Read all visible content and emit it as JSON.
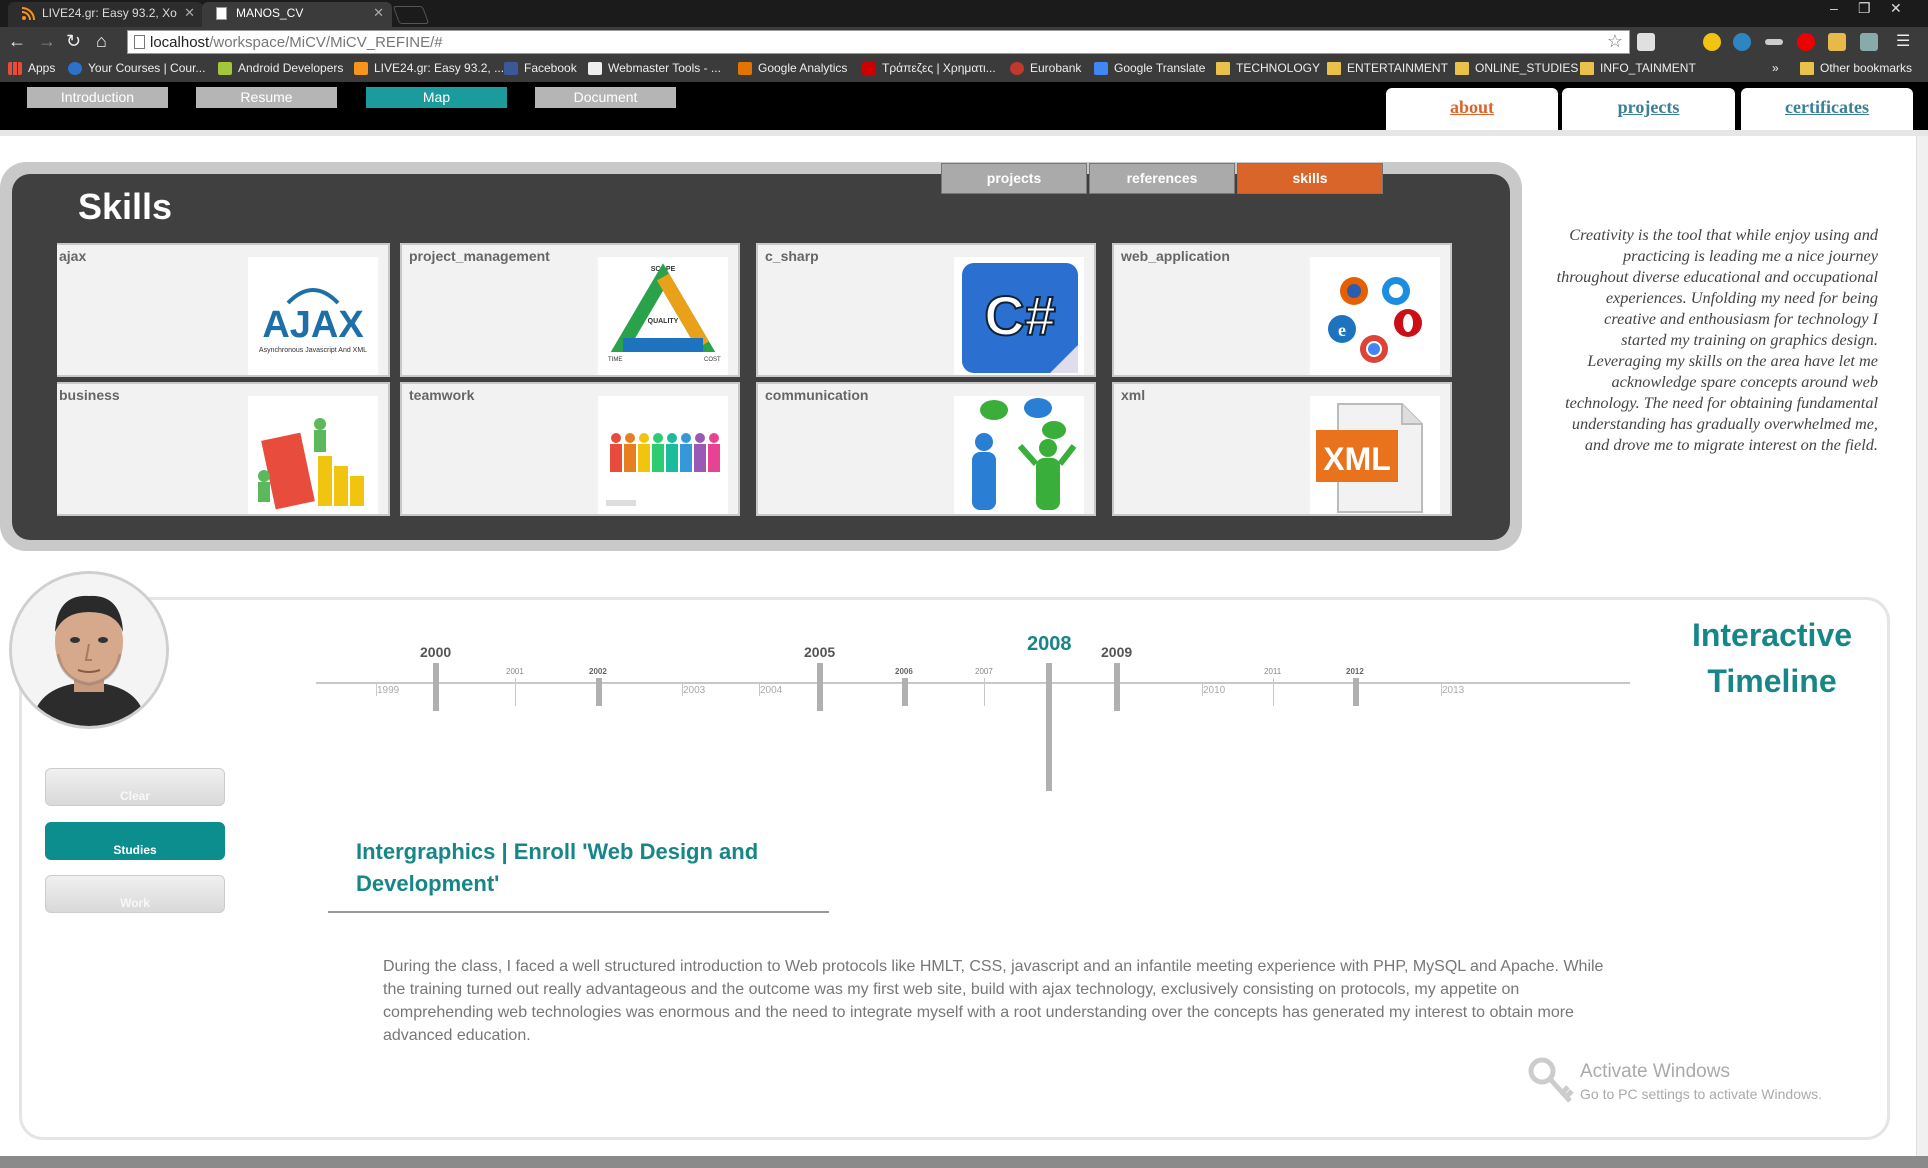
{
  "browser": {
    "tabs": [
      {
        "label": "LIVE24.gr: Easy 93.2, Xo"
      },
      {
        "label": "MANOS_CV"
      }
    ],
    "url_host": "localhost",
    "url_path": "/workspace/MiCV/MiCV_REFINE/#",
    "bookmarks": [
      "Apps",
      "Your Courses | Cour...",
      "Android Developers",
      "LIVE24.gr: Easy 93.2, ...",
      "Facebook",
      "Webmaster Tools - ...",
      "Google Analytics",
      "Τράπεζες | Χρηματι...",
      "Eurobank",
      "Google Translate",
      "TECHNOLOGY",
      "ENTERTAINMENT",
      "ONLINE_STUDIES",
      "INFO_TAINMENT"
    ],
    "other_bookmarks": "Other bookmarks",
    "more": "»"
  },
  "site_nav": {
    "left": [
      "Introduction",
      "Resume",
      "Map",
      "Document"
    ],
    "right": [
      "about",
      "projects",
      "certificates"
    ]
  },
  "skills": {
    "title": "Skills",
    "tabs": [
      "projects",
      "references",
      "skills"
    ],
    "cards": [
      "ajax",
      "project_management",
      "c_sharp",
      "web_application",
      "business",
      "teamwork",
      "communication",
      "xml"
    ],
    "image_text": {
      "ajax_big": "AJAX",
      "ajax_small": "Asynchronous Javascript And XML",
      "pm_scope": "SCOPE",
      "pm_quality": "QUALITY",
      "pm_time": "TIME",
      "pm_cost": "COST",
      "csharp": "C#",
      "xml": "XML"
    }
  },
  "quote": "Creativity is the tool that while enjoy using and practicing is leading me a nice journey throughout diverse educational and occupational experiences. Unfolding my need for being creative and enthousiasm for technology I started my training on graphics design. Leveraging my skills on the area have let me acknowledge spare concepts around web technology. The need for obtaining fundamental understanding has gradually overwhelmed me, and drove me to migrate interest on the field.",
  "timeline": {
    "title": "Interactive Timeline",
    "buttons": [
      "Clear",
      "Studies",
      "Work"
    ],
    "years": [
      {
        "y": "1999",
        "kind": "minor"
      },
      {
        "y": "2000",
        "kind": "major"
      },
      {
        "y": "2001",
        "kind": "tick"
      },
      {
        "y": "2002",
        "kind": "event"
      },
      {
        "y": "2003",
        "kind": "minor"
      },
      {
        "y": "2004",
        "kind": "minor"
      },
      {
        "y": "2005",
        "kind": "major"
      },
      {
        "y": "2006",
        "kind": "event"
      },
      {
        "y": "2007",
        "kind": "tick"
      },
      {
        "y": "2008",
        "kind": "selected"
      },
      {
        "y": "2009",
        "kind": "major"
      },
      {
        "y": "2010",
        "kind": "minor"
      },
      {
        "y": "2011",
        "kind": "tick"
      },
      {
        "y": "2012",
        "kind": "event"
      },
      {
        "y": "2013",
        "kind": "minor"
      }
    ],
    "event_title": "Intergraphics | Enroll 'Web Design and Development'",
    "event_description": "During the class, I faced a well structured introduction to Web protocols like HMLT, CSS, javascript and an infantile meeting experience with PHP, MySQL and Apache. While the training turned out really advantageous and the outcome was my first web site, build with ajax technology, exclusively consisting on protocols, my appetite on comprehending web technologies was enormous and the need to integrate myself with a root understanding over the concepts has generated my interest to obtain more advanced education."
  },
  "watermark": {
    "line1": "Activate Windows",
    "line2": "Go to PC settings to activate Windows."
  }
}
